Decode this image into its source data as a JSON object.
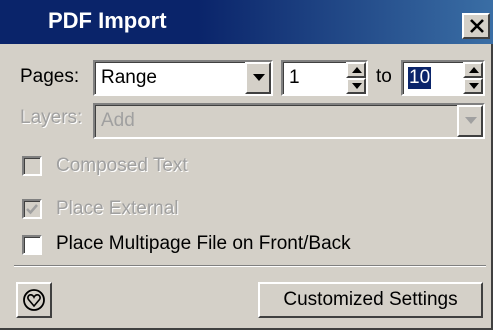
{
  "window": {
    "title": "PDF Import",
    "close_icon": "close-icon"
  },
  "pages": {
    "label": "Pages:",
    "mode_value": "Range",
    "from_value": "1",
    "to_label": "to",
    "to_value": "10"
  },
  "layers": {
    "label": "Layers:",
    "value": "Add",
    "disabled": true
  },
  "options": {
    "composed_text": {
      "label": "Composed Text",
      "checked": false,
      "disabled": true
    },
    "place_external": {
      "label": "Place External",
      "checked": true,
      "disabled": true
    },
    "place_multipage": {
      "label": "Place Multipage File on Front/Back",
      "checked": false,
      "disabled": false
    }
  },
  "footer": {
    "help_icon": "heart-help-icon",
    "customized_settings_label": "Customized Settings"
  },
  "colors": {
    "titlebar": "#0a246a",
    "dialog_bg": "#d4d0c8",
    "selection": "#0a246a",
    "disabled_text": "#a0a0a0"
  }
}
